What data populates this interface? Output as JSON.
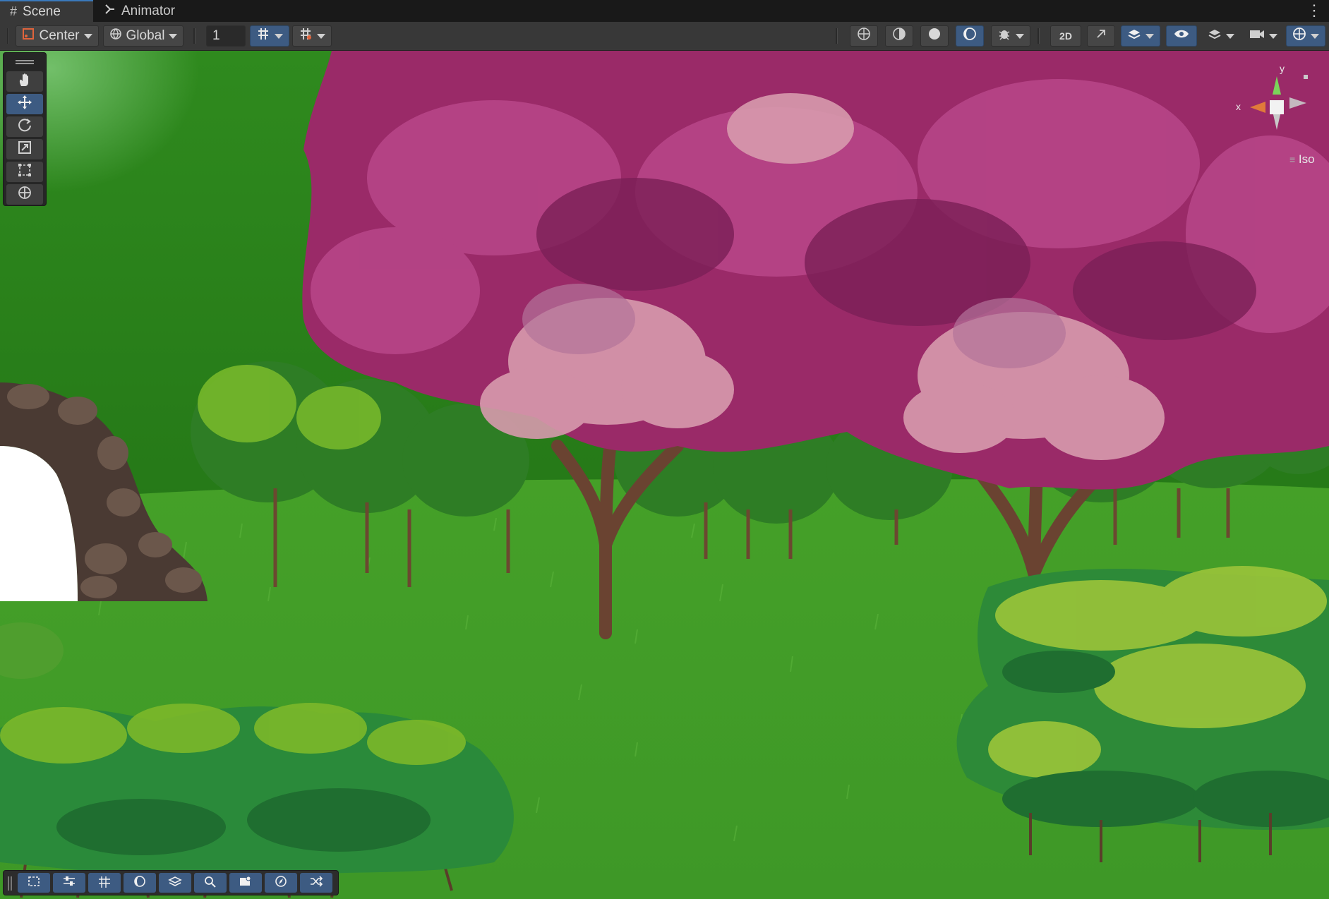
{
  "tabs": [
    {
      "label": "Scene",
      "icon": "grid-hash-icon",
      "active": true
    },
    {
      "label": "Animator",
      "icon": "animator-graph-icon",
      "active": false
    }
  ],
  "toolbar": {
    "pivot_label": "Center",
    "space_label": "Global",
    "grid_snap_value": "1"
  },
  "gizmo": {
    "projection_label": "Iso",
    "x_axis": "x",
    "y_axis": "y"
  },
  "colors": {
    "accent_blue": "#3d5b82",
    "tab_highlight": "#3a79bb",
    "toolbar_bg": "#383838",
    "grass": "#3a8f2a",
    "blossom": "#b0407a"
  }
}
